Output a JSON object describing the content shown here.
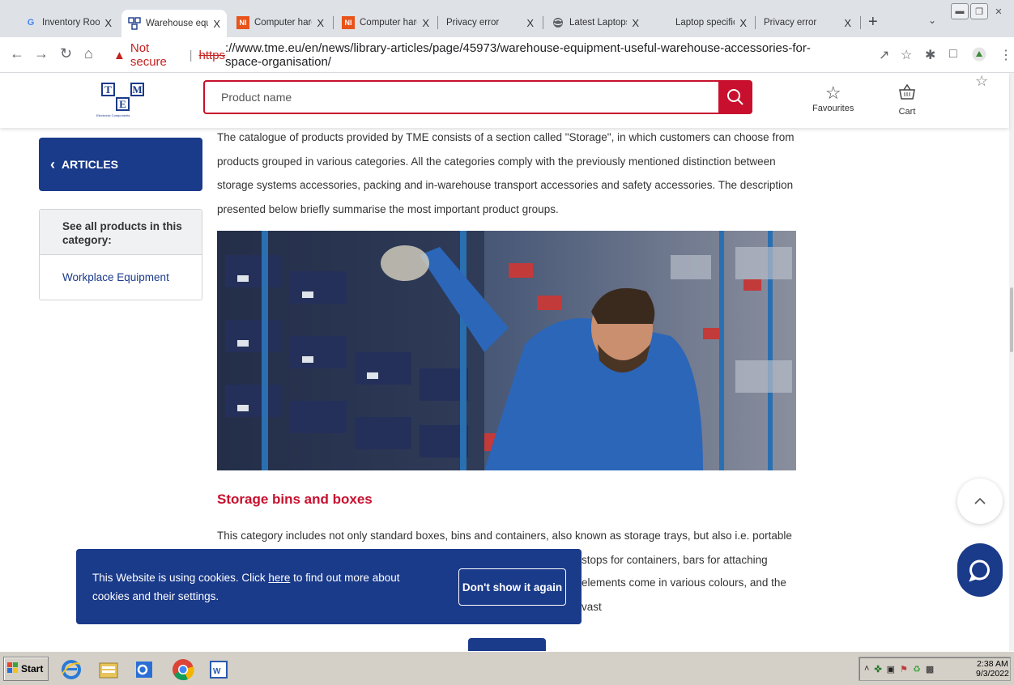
{
  "browser": {
    "tabs": [
      {
        "title": "Inventory Room",
        "favicon": "google-g-icon",
        "color": "#4285f4"
      },
      {
        "title": "Warehouse equ",
        "favicon": "tme-icon",
        "color": "#1a3a8a",
        "active": true
      },
      {
        "title": "Computer hardv",
        "favicon": "ni-icon",
        "color": "#e8531a"
      },
      {
        "title": "Computer hardv",
        "favicon": "ni-icon",
        "color": "#e8531a"
      },
      {
        "title": "Privacy error",
        "favicon": "none"
      },
      {
        "title": "Latest Laptops",
        "favicon": "globe-icon",
        "color": "#5f6368"
      },
      {
        "title": "Laptop specifica",
        "favicon": "none"
      },
      {
        "title": "Privacy error",
        "favicon": "none"
      }
    ],
    "close_glyph": "X",
    "new_tab_glyph": "+",
    "security_label": "Not secure",
    "url_protocol": "https",
    "url_rest": "://www.tme.eu/en/news/library-articles/page/45973/warehouse-equipment-useful-warehouse-accessories-for-space-organisation/"
  },
  "header": {
    "logo_letters": [
      "T",
      "M",
      "E"
    ],
    "logo_sub": "Electronic Components",
    "search_placeholder": "Product name",
    "favourites_label": "Favourites",
    "cart_label": "Cart"
  },
  "sidebar": {
    "articles_label": "ARTICLES",
    "category_heading": "See all products in this category:",
    "category_link": "Workplace Equipment"
  },
  "article": {
    "intro": "The catalogue of products provided by TME consists of a section called \"Storage\", in which customers can choose from products grouped in various categories. All the categories comply with the previously mentioned distinction between storage systems accessories, packing and in-warehouse transport accessories and safety accessories. The description presented below briefly summarise the most important product groups.",
    "section_heading": "Storage bins and boxes",
    "section_line1": "This category includes not only standard boxes, bins and containers, also known as storage trays, but also i.e. portable boxes,",
    "section_line2_tail": "stops for containers, bars for attaching",
    "section_line3_tail": "elements come in various colours, and the vast"
  },
  "cookie": {
    "text_before": "This Website is using cookies. Click",
    "link_text": "here",
    "text_after": "to find out more about cookies and their settings.",
    "button_label": "Don't show it again"
  },
  "taskbar": {
    "start_label": "Start",
    "clock_time": "2:38 AM",
    "clock_date": "9/3/2022"
  },
  "colors": {
    "brand_blue": "#1a3a8a",
    "brand_red": "#c8102e"
  }
}
